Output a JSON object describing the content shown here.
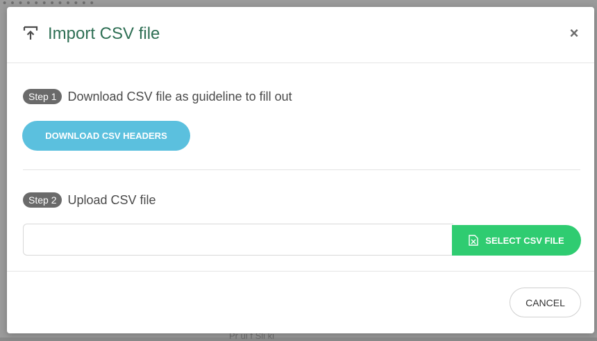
{
  "backdrop": {
    "top_text": "• • • • • • • • • • • •",
    "bottom_text": "Pr  ui  f  Sli  ki"
  },
  "dialog": {
    "title": "Import CSV file",
    "close_label": "×",
    "icon": "upload-icon"
  },
  "step1": {
    "badge": "Step 1",
    "text": "Download CSV file as guideline to fill out",
    "button_label": "DOWNLOAD CSV HEADERS"
  },
  "step2": {
    "badge": "Step 2",
    "text": "Upload CSV file",
    "file_input_value": "",
    "button_label": "SELECT CSV FILE",
    "button_icon": "csv-file-icon"
  },
  "footer": {
    "cancel_label": "CANCEL"
  },
  "colors": {
    "title": "#2e6f54",
    "download_button": "#5bc0de",
    "select_button": "#2fcc71",
    "badge": "#6a6a6a"
  }
}
